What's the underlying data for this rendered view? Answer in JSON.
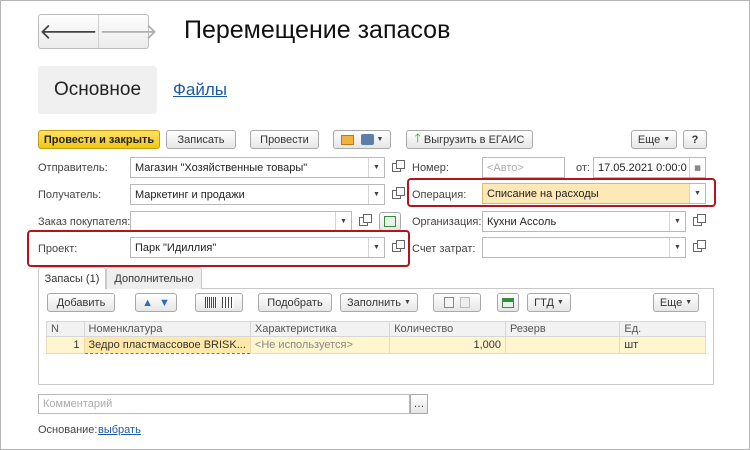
{
  "nav": {
    "back": "🡐",
    "forward": "🡒"
  },
  "title": "Перемещение запасов",
  "tabs_top": {
    "main": "Основное",
    "files": "Файлы"
  },
  "toolbar": {
    "post_close": "Провести и закрыть",
    "save": "Записать",
    "post": "Провести",
    "egais": "Выгрузить в ЕГАИС",
    "more": "Еще",
    "help": "?"
  },
  "form": {
    "sender_label": "Отправитель:",
    "sender_value": "Магазин \"Хозяйственные товары\"",
    "recipient_label": "Получатель:",
    "recipient_value": "Маркетинг и продажи",
    "order_label": "Заказ покупателя:",
    "order_value": "",
    "project_label": "Проект:",
    "project_value": "Парк \"Идиллия\"",
    "number_label": "Номер:",
    "number_placeholder": "<Авто>",
    "date_label": "от:",
    "date_value": "17.05.2021  0:00:0",
    "operation_label": "Операция:",
    "operation_value": "Списание на расходы",
    "org_label": "Организация:",
    "org_value": "Кухни Ассоль",
    "cost_label": "Счет затрат:",
    "cost_value": ""
  },
  "tabs_inner": {
    "stock": "Запасы (1)",
    "extra": "Дополнительно"
  },
  "table_toolbar": {
    "add": "Добавить",
    "pick": "Подобрать",
    "fill": "Заполнить",
    "gtd": "ГТД",
    "more": "Еще"
  },
  "table": {
    "headers": [
      "N",
      "Номенклатура",
      "Характеристика",
      "Количество",
      "Резерв",
      "Ед."
    ],
    "rows": [
      {
        "n": "1",
        "item": "Зедро пластмассовое BRISK...",
        "char": "<Не используется>",
        "qty": "1,000",
        "reserve": "",
        "unit": "шт"
      }
    ]
  },
  "comment_placeholder": "Комментарий",
  "basis_label": "Основание:",
  "basis_link": "выбрать",
  "colors": {
    "primary": "#f2c616",
    "highlight": "#fde8b6",
    "annotation": "#b3141d",
    "link": "#1c5aa8"
  }
}
